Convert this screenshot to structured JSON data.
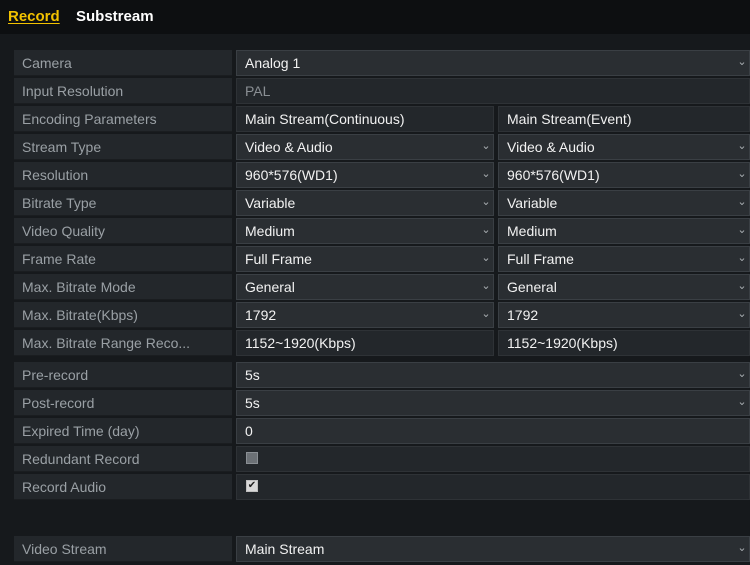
{
  "tabs": [
    {
      "label": "Record"
    },
    {
      "label": "Substream"
    }
  ],
  "fields": {
    "camera": {
      "label": "Camera",
      "value": "Analog 1"
    },
    "input_resolution": {
      "label": "Input Resolution",
      "value": "PAL"
    },
    "encoding_parameters": {
      "label": "Encoding Parameters",
      "col1": "Main Stream(Continuous)",
      "col2": "Main Stream(Event)"
    },
    "stream_type": {
      "label": "Stream Type",
      "col1": "Video & Audio",
      "col2": "Video & Audio"
    },
    "resolution": {
      "label": "Resolution",
      "col1": "960*576(WD1)",
      "col2": "960*576(WD1)"
    },
    "bitrate_type": {
      "label": "Bitrate Type",
      "col1": "Variable",
      "col2": "Variable"
    },
    "video_quality": {
      "label": "Video Quality",
      "col1": "Medium",
      "col2": "Medium"
    },
    "frame_rate": {
      "label": "Frame Rate",
      "col1": "Full Frame",
      "col2": "Full Frame"
    },
    "max_bitrate_mode": {
      "label": "Max. Bitrate Mode",
      "col1": "General",
      "col2": "General"
    },
    "max_bitrate": {
      "label": "Max. Bitrate(Kbps)",
      "col1": "1792",
      "col2": "1792"
    },
    "max_bitrate_range": {
      "label": "Max. Bitrate Range Reco...",
      "col1": "1152~1920(Kbps)",
      "col2": "1152~1920(Kbps)"
    },
    "pre_record": {
      "label": "Pre-record",
      "value": "5s"
    },
    "post_record": {
      "label": "Post-record",
      "value": "5s"
    },
    "expired_time": {
      "label": "Expired Time (day)",
      "value": "0"
    },
    "redundant_record": {
      "label": "Redundant Record",
      "checked": false
    },
    "record_audio": {
      "label": "Record Audio",
      "checked": true,
      "check_glyph": "✔"
    },
    "video_stream": {
      "label": "Video Stream",
      "value": "Main Stream"
    }
  },
  "dropdown_arrow": "⌄",
  "colors": {
    "accent": "#f2c200",
    "background": "#16191c"
  }
}
